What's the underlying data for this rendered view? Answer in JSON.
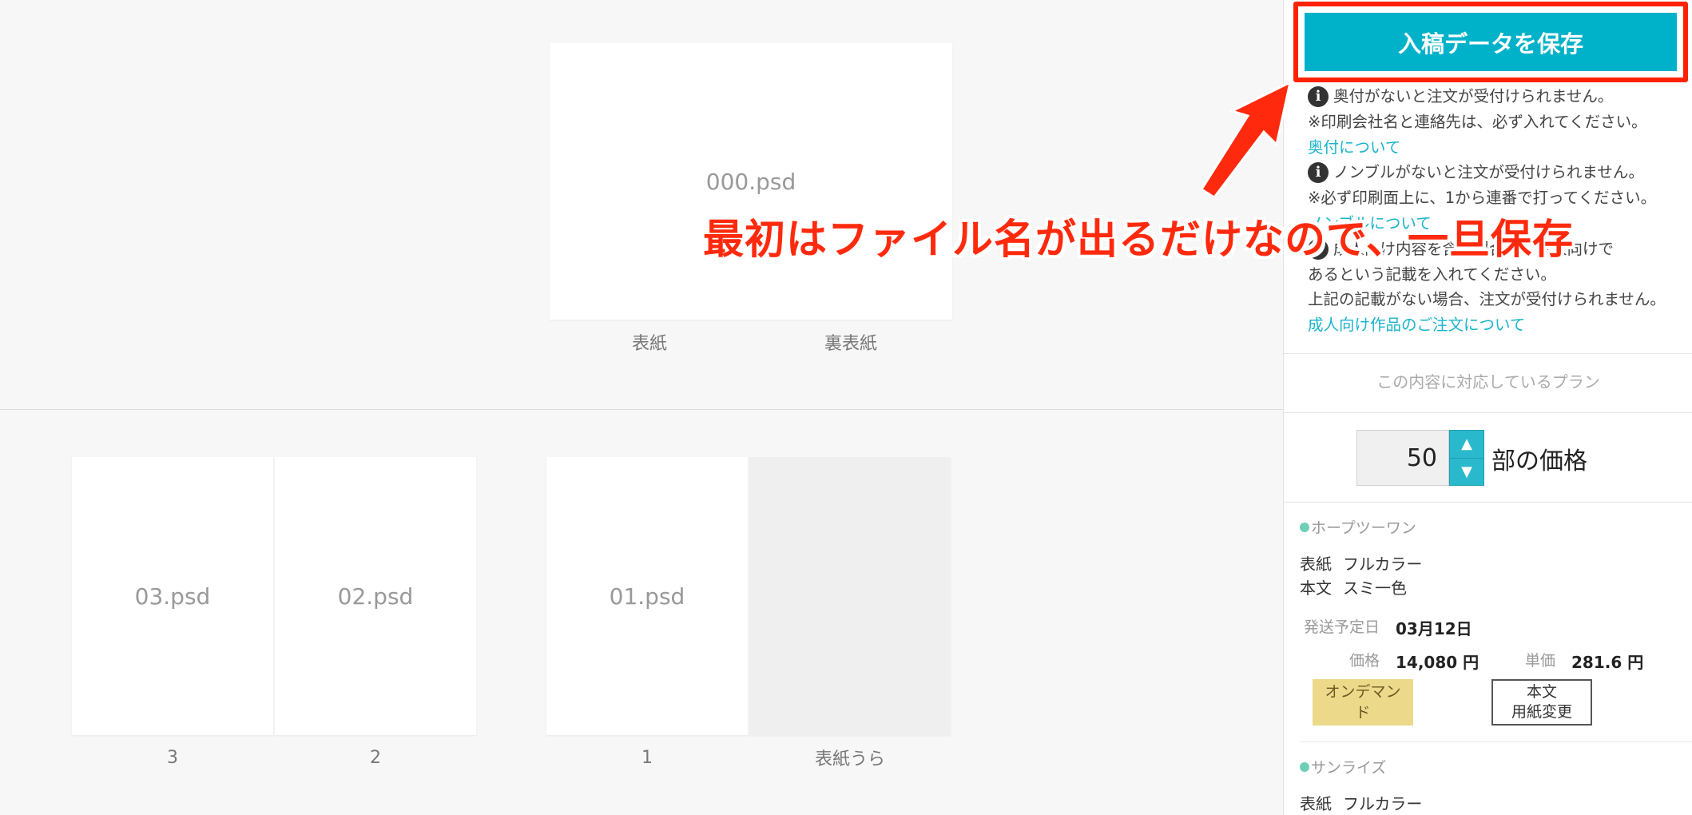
{
  "spreads": {
    "cover": {
      "file": "000.psd",
      "label_front": "表紙",
      "label_back": "裏表紙"
    },
    "pages": [
      {
        "file": "03.psd",
        "label": "3"
      },
      {
        "file": "02.psd",
        "label": "2"
      },
      {
        "file": "01.psd",
        "label": "1"
      },
      {
        "file": "",
        "label": "表紙うら"
      }
    ]
  },
  "sidebar": {
    "save_button": "入稿データを保存",
    "notes": {
      "okuzuke_warning": "奥付がないと注文が受付けられません。",
      "okuzuke_note": "※印刷会社名と連絡先は、必ず入れてください。",
      "okuzuke_link": "奥付について",
      "nombre_warning": "ノンブルがないと注文が受付けられません。",
      "nombre_note": "※必ず印刷面上に、1から連番で打ってください。",
      "nombre_link": "ノンブルについて",
      "adult_warning": "成人向け内容を含む場合は、成人向けで",
      "adult_warning2": "あるという記載を入れてください。",
      "adult_warning3": "上記の記載がない場合、注文が受付けられません。",
      "adult_link": "成人向け作品のご注文について"
    },
    "plan_heading": "この内容に対応しているプラン",
    "quantity": "50",
    "quantity_suffix": "部の価格",
    "plans": [
      {
        "name": "ホープツーワン",
        "cover_key": "表紙",
        "cover_val": "フルカラー",
        "body_key": "本文",
        "body_val": "スミ一色",
        "ship_label": "発送予定日",
        "ship_val": "03月12日",
        "price_label": "価格",
        "price_val": "14,080 円",
        "unit_label": "単価",
        "unit_val": "281.6 円",
        "badge_ondemand": [
          "オンデマン",
          "ド"
        ],
        "badge_paper": [
          "本文",
          "用紙変更"
        ]
      },
      {
        "name": "サンライズ",
        "cover_key": "表紙",
        "cover_val": "フルカラー"
      }
    ]
  },
  "annotation": {
    "text": "最初はファイル名が出るだけなので、一旦保存",
    "color": "#ff2a0d"
  },
  "colors": {
    "accent": "#00b2c9",
    "link": "#1ab4cc",
    "highlight_border": "#ff2200"
  }
}
